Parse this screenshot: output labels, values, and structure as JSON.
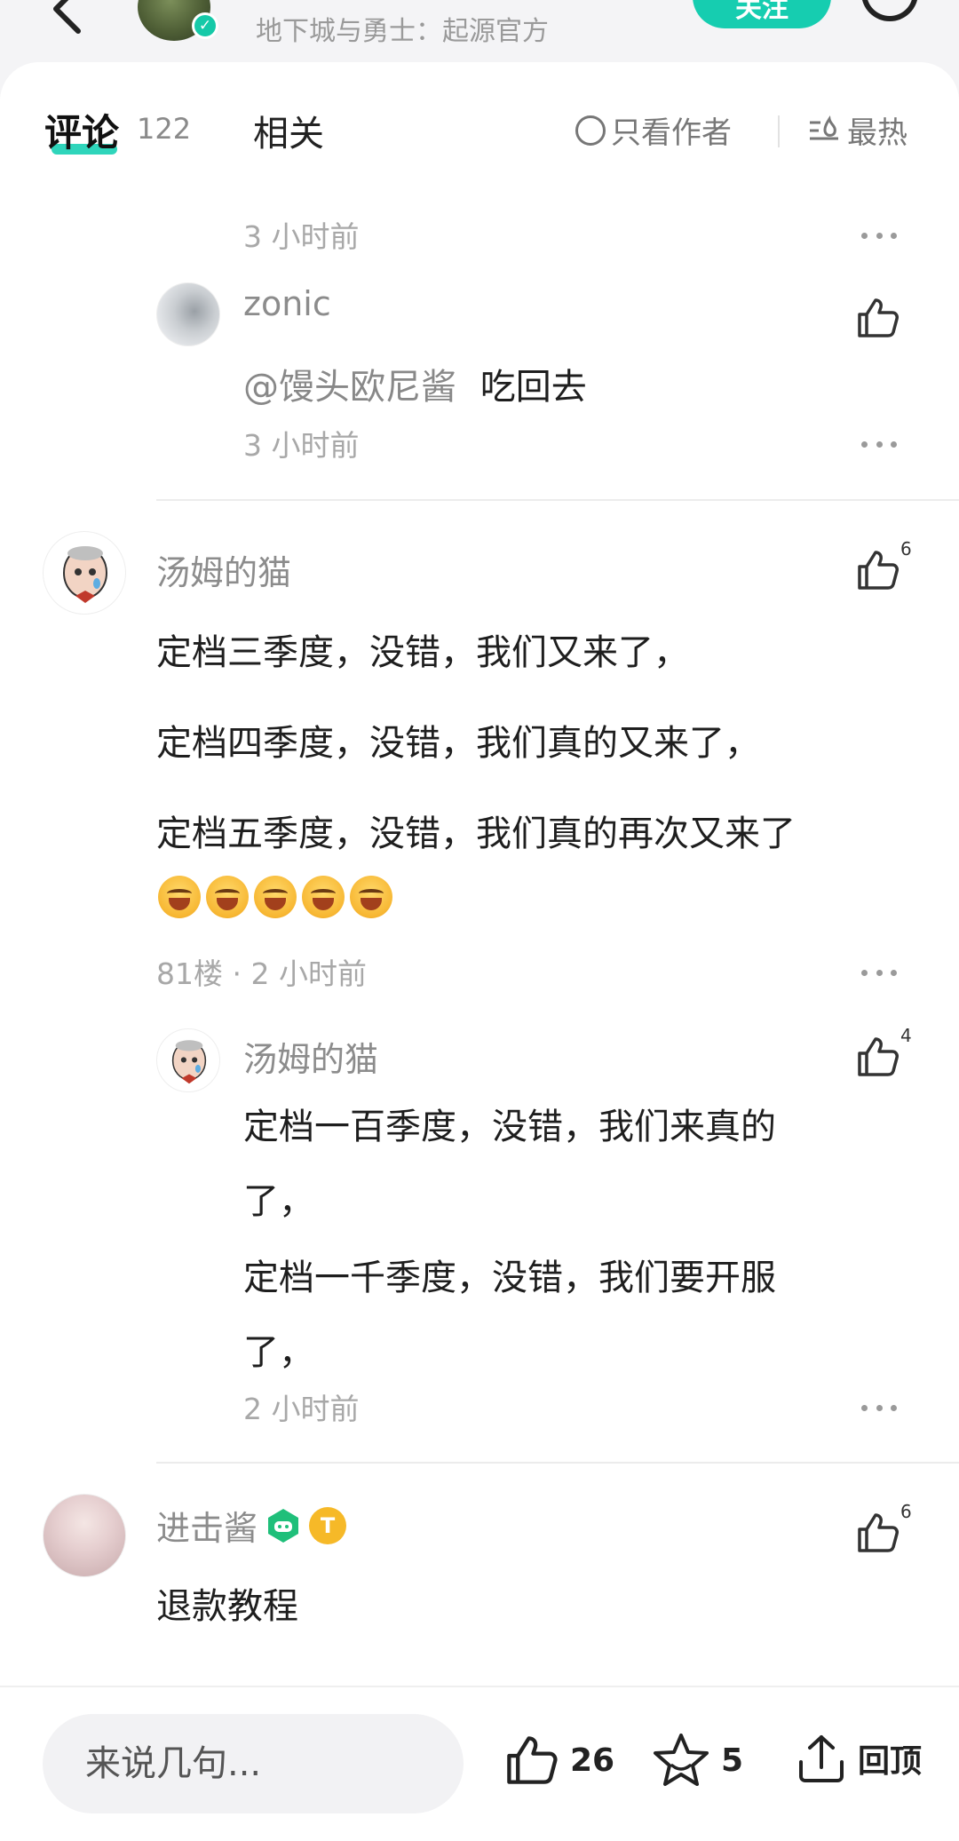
{
  "header": {
    "author_name": "地下城与勇士：起源官方",
    "follow_label": "关注",
    "verified_mark": "✓"
  },
  "tabs": {
    "comments_label": "评论",
    "comments_count": "122",
    "related_label": "相关",
    "author_only_label": "只看作者",
    "sort_label": "最热"
  },
  "comments": {
    "reply_top": {
      "time": "3 小时前"
    },
    "reply_zonic": {
      "name": "zonic",
      "mention": "@馒头欧尼酱",
      "text": "吃回去",
      "time": "3 小时前"
    },
    "main_tom": {
      "name": "汤姆的猫",
      "likes": "6",
      "lines": [
        "定档三季度，没错，我们又来了，",
        "定档四季度，没错，我们真的又来了，",
        "定档五季度，没错，我们真的再次又来了"
      ],
      "emoji_count": 5,
      "meta": "81楼 · 2 小时前"
    },
    "reply_tom": {
      "name": "汤姆的猫",
      "likes": "4",
      "lines": [
        "定档一百季度，没错，我们来真的",
        "了，",
        "定档一千季度，没错，我们要开服",
        "了，"
      ],
      "time": "2 小时前"
    },
    "main_jinji": {
      "name": "进击酱",
      "likes": "6",
      "badge_t": "T",
      "text": "退款教程"
    }
  },
  "bottom_bar": {
    "input_placeholder": "来说几句...",
    "like_count": "26",
    "favorite_count": "5",
    "top_label": "回顶"
  },
  "colors": {
    "accent": "#16cdb0",
    "text_grey": "#9b9b9b"
  }
}
